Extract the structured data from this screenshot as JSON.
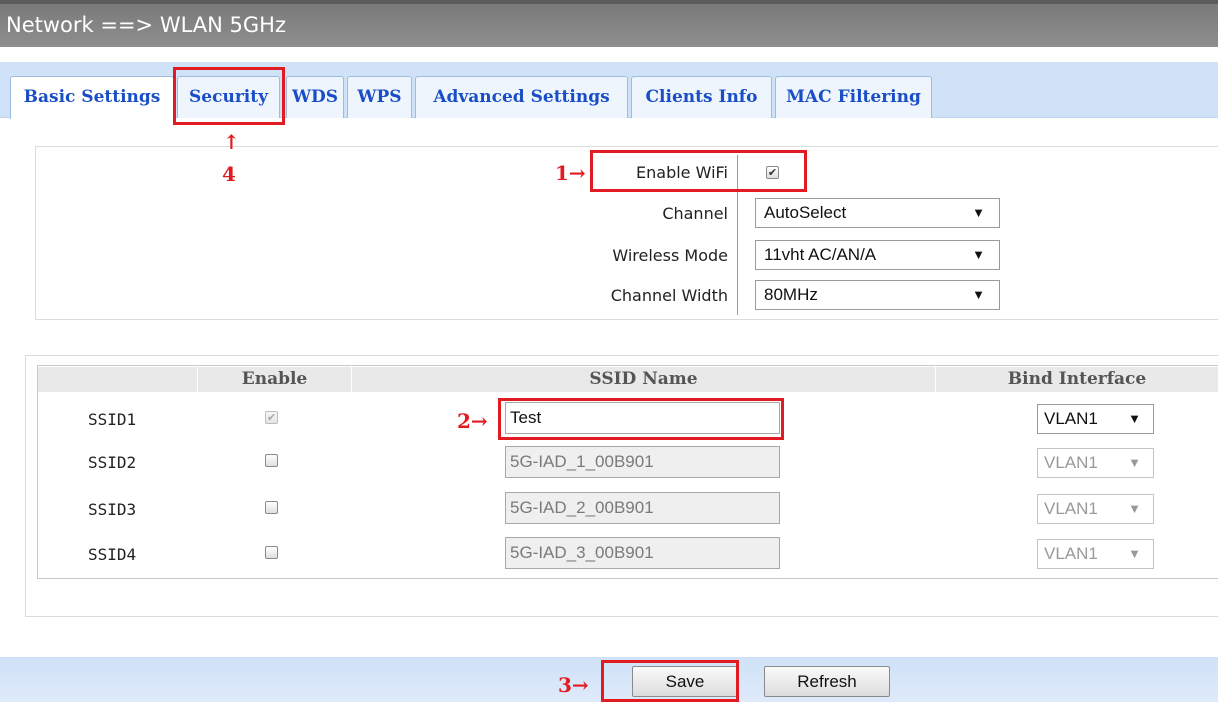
{
  "header": {
    "title": "Network ==> WLAN 5GHz"
  },
  "tabs": [
    {
      "label": "Basic Settings",
      "active": true
    },
    {
      "label": "Security"
    },
    {
      "label": "WDS"
    },
    {
      "label": "WPS"
    },
    {
      "label": "Advanced Settings"
    },
    {
      "label": "Clients Info"
    },
    {
      "label": "MAC Filtering"
    }
  ],
  "settings": {
    "enable_wifi": {
      "label": "Enable WiFi",
      "checked": true
    },
    "channel": {
      "label": "Channel",
      "value": "AutoSelect"
    },
    "wireless_mode": {
      "label": "Wireless Mode",
      "value": "11vht AC/AN/A"
    },
    "channel_width": {
      "label": "Channel Width",
      "value": "80MHz"
    }
  },
  "ssid_table": {
    "headers": [
      "Enable",
      "SSID Name",
      "Bind Interface"
    ],
    "rows": [
      {
        "ssid": "SSID1",
        "enabled": true,
        "name": "Test",
        "vlan": "VLAN1",
        "editable": true
      },
      {
        "ssid": "SSID2",
        "enabled": false,
        "name": "5G-IAD_1_00B901",
        "vlan": "VLAN1",
        "editable": false
      },
      {
        "ssid": "SSID3",
        "enabled": false,
        "name": "5G-IAD_2_00B901",
        "vlan": "VLAN1",
        "editable": false
      },
      {
        "ssid": "SSID4",
        "enabled": false,
        "name": "5G-IAD_3_00B901",
        "vlan": "VLAN1",
        "editable": false
      }
    ]
  },
  "buttons": {
    "save": "Save",
    "refresh": "Refresh"
  },
  "annotations": {
    "step1": "1→",
    "step2": "2→",
    "step3": "3→",
    "step4_arrow": "↑",
    "step4": "4"
  },
  "colors": {
    "highlight": "#e21b23",
    "tab_text": "#1a4ec6",
    "tab_strip": "#cfe2f7"
  },
  "icons": {
    "select_caret": "▼",
    "check": "✔"
  }
}
